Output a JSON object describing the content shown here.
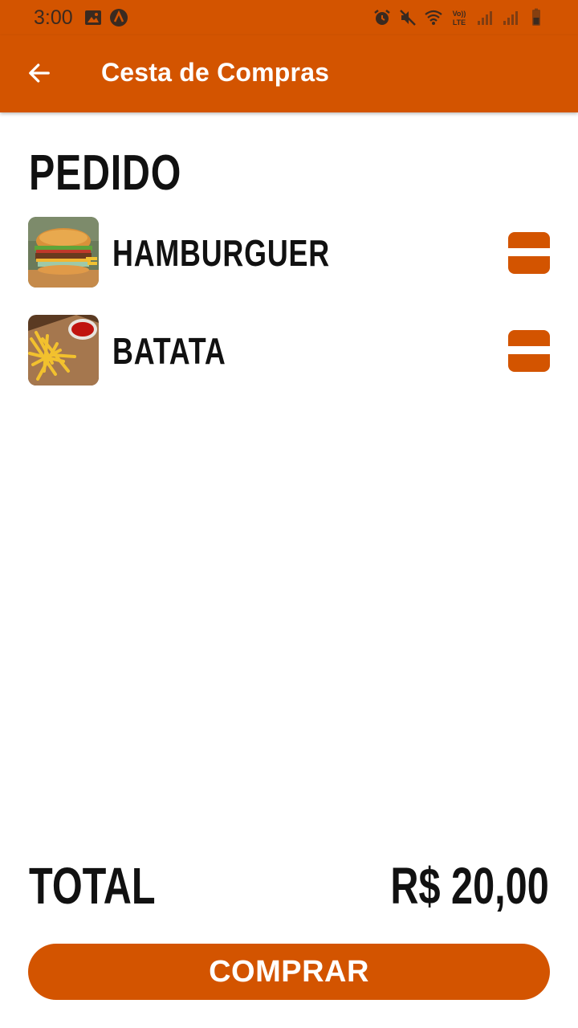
{
  "status_bar": {
    "time": "3:00",
    "icons": [
      "image-icon",
      "app-badge-icon",
      "alarm-icon",
      "mute-icon",
      "wifi-icon",
      "volte-icon",
      "signal-icon",
      "signal-icon-2",
      "battery-icon"
    ],
    "volte_label": "Vo))\nLTE"
  },
  "app_bar": {
    "title": "Cesta de Compras",
    "back_icon": "arrow-left-icon"
  },
  "order": {
    "section_title": "PEDIDO",
    "items": [
      {
        "name": "HAMBURGUER",
        "image": "burger-image"
      },
      {
        "name": "BATATA",
        "image": "fries-image"
      }
    ]
  },
  "summary": {
    "total_label": "TOTAL",
    "total_value": "R$ 20,00"
  },
  "actions": {
    "buy_label": "COMPRAR"
  },
  "colors": {
    "primary": "#d35400",
    "text": "#111111",
    "background": "#ffffff"
  }
}
